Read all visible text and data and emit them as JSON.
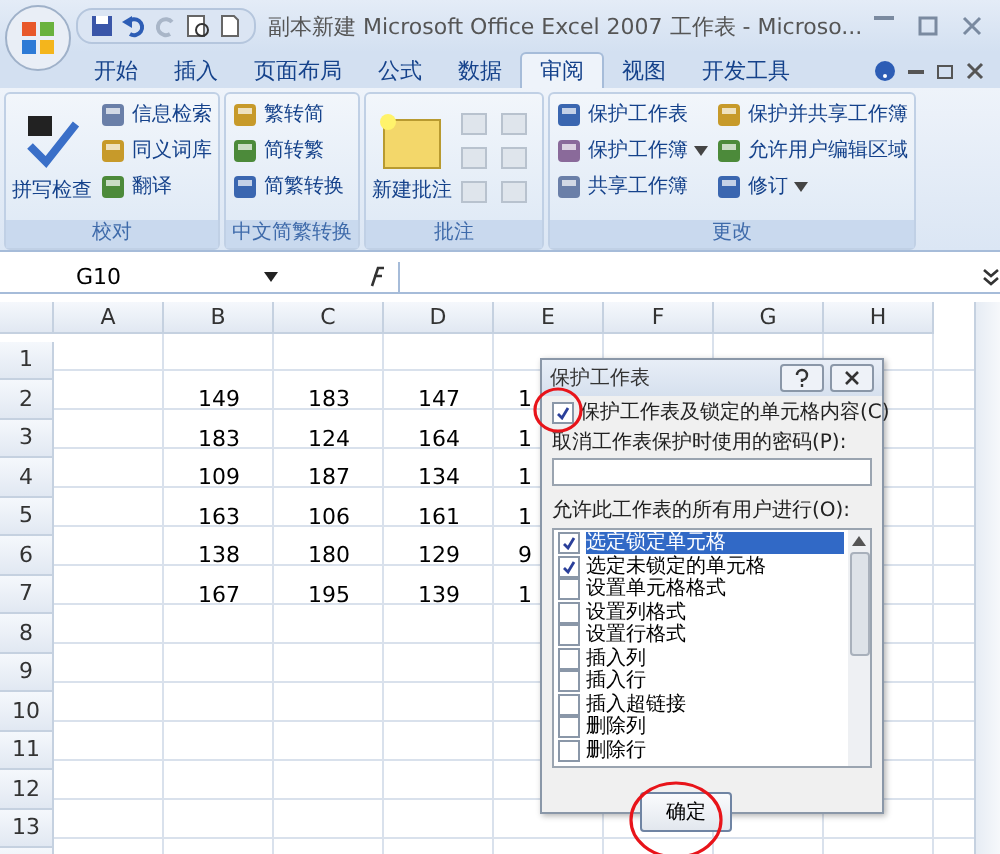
{
  "window": {
    "title": "副本新建 Microsoft Office Excel 2007 工作表 - Microso..."
  },
  "tabs": [
    {
      "label": "开始",
      "selected": false
    },
    {
      "label": "插入",
      "selected": false
    },
    {
      "label": "页面布局",
      "selected": false
    },
    {
      "label": "公式",
      "selected": false
    },
    {
      "label": "数据",
      "selected": false
    },
    {
      "label": "审阅",
      "selected": true
    },
    {
      "label": "视图",
      "selected": false
    },
    {
      "label": "开发工具",
      "selected": false
    }
  ],
  "ribbon_groups": [
    {
      "label": "校对",
      "large": "拼写检查",
      "items": [
        {
          "label": "信息检索",
          "dropdown": false
        },
        {
          "label": "同义词库",
          "dropdown": false
        },
        {
          "label": "翻译",
          "dropdown": false
        }
      ]
    },
    {
      "label": "中文简繁转换",
      "items": [
        {
          "label": "繁转简",
          "dropdown": false
        },
        {
          "label": "简转繁",
          "dropdown": false
        },
        {
          "label": "简繁转换",
          "dropdown": false
        }
      ]
    },
    {
      "label": "批注",
      "large": "新建批注"
    },
    {
      "label": "更改",
      "items": [
        {
          "label": "保护工作表",
          "dropdown": false
        },
        {
          "label": "保护工作簿",
          "dropdown": true
        },
        {
          "label": "共享工作簿",
          "dropdown": false
        },
        {
          "label": "保护并共享工作簿",
          "dropdown": false
        },
        {
          "label": "允许用户编辑区域",
          "dropdown": false
        },
        {
          "label": "修订",
          "dropdown": true
        }
      ]
    }
  ],
  "name_box": "G10",
  "sheet": {
    "columns": [
      "A",
      "B",
      "C",
      "D",
      "E",
      "F",
      "G",
      "H"
    ],
    "rows": [
      {
        "number": "1"
      },
      {
        "number": "2",
        "values": [
          "149",
          "183",
          "147",
          "1"
        ]
      },
      {
        "number": "3",
        "values": [
          "183",
          "124",
          "164",
          "1"
        ]
      },
      {
        "number": "4",
        "values": [
          "109",
          "187",
          "134",
          "1"
        ]
      },
      {
        "number": "5",
        "values": [
          "163",
          "106",
          "161",
          "1"
        ]
      },
      {
        "number": "6",
        "values": [
          "138",
          "180",
          "129",
          "9"
        ]
      },
      {
        "number": "7",
        "values": [
          "167",
          "195",
          "139",
          "1"
        ]
      },
      {
        "number": "8"
      },
      {
        "number": "9"
      },
      {
        "number": "10"
      },
      {
        "number": "11"
      },
      {
        "number": "12"
      },
      {
        "number": "13"
      }
    ]
  },
  "dialog": {
    "title": "保护工作表",
    "protect": {
      "label": "保护工作表及锁定的单元格内容(C)",
      "checked": true,
      "highlighted": true
    },
    "password_label": "取消工作表保护时使用的密码(P):",
    "list_label": "允许此工作表的所有用户进行(O):",
    "permissions": [
      {
        "label": "选定锁定单元格",
        "checked": true,
        "selected": true
      },
      {
        "label": "选定未锁定的单元格",
        "checked": true,
        "selected": false
      },
      {
        "label": "设置单元格格式",
        "checked": false,
        "selected": false
      },
      {
        "label": "设置列格式",
        "checked": false,
        "selected": false
      },
      {
        "label": "设置行格式",
        "checked": false,
        "selected": false
      },
      {
        "label": "插入列",
        "checked": false,
        "selected": false
      },
      {
        "label": "插入行",
        "checked": false,
        "selected": false
      },
      {
        "label": "插入超链接",
        "checked": false,
        "selected": false
      },
      {
        "label": "删除列",
        "checked": false,
        "selected": false
      },
      {
        "label": "删除行",
        "checked": false,
        "selected": false
      }
    ],
    "ok_button": {
      "label": "确定",
      "highlighted": true
    }
  }
}
